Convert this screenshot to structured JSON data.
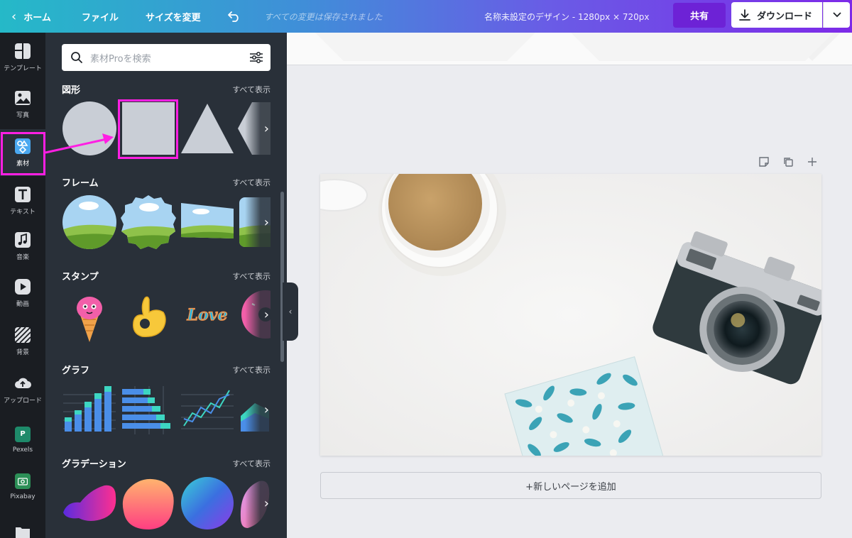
{
  "topbar": {
    "home": "ホーム",
    "file": "ファイル",
    "resize": "サイズを変更",
    "saved_status": "すべての変更は保存されました",
    "design_title": "名称未設定のデザイン - 1280px × 720px",
    "share": "共有",
    "download": "ダウンロード"
  },
  "rail": {
    "items": [
      {
        "label": "テンプレート",
        "icon": "template-icon"
      },
      {
        "label": "写真",
        "icon": "photo-icon"
      },
      {
        "label": "素材",
        "icon": "elements-icon"
      },
      {
        "label": "テキスト",
        "icon": "text-icon"
      },
      {
        "label": "音楽",
        "icon": "music-icon"
      },
      {
        "label": "動画",
        "icon": "video-icon"
      },
      {
        "label": "背景",
        "icon": "background-icon"
      },
      {
        "label": "アップロード",
        "icon": "upload-icon"
      },
      {
        "label": "Pexels",
        "icon": "pexels-icon"
      },
      {
        "label": "Pixabay",
        "icon": "pixabay-icon"
      }
    ]
  },
  "panel": {
    "search_placeholder": "素材Proを検索",
    "sections": [
      {
        "title": "図形",
        "see_all": "すべて表示"
      },
      {
        "title": "フレーム",
        "see_all": "すべて表示"
      },
      {
        "title": "スタンプ",
        "see_all": "すべて表示"
      },
      {
        "title": "グラフ",
        "see_all": "すべて表示"
      },
      {
        "title": "グラデーション",
        "see_all": "すべて表示"
      }
    ],
    "sticker_love_text": "Love"
  },
  "canvas": {
    "add_page": "+新しいページを追加"
  },
  "colors": {
    "highlight": "#ff1fe3",
    "panel_bg": "#293039",
    "rail_bg": "#1a1d22",
    "share_bg": "#6d22d6"
  }
}
